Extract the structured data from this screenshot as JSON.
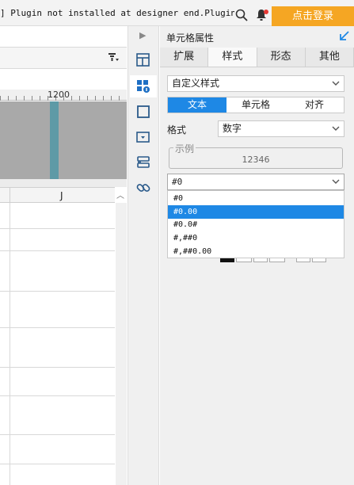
{
  "topbar": {
    "notice": "] Plugin not installed at designer end.Plugin ...",
    "search_icon": "search-icon",
    "bell_icon": "bell-icon",
    "login_label": "点击登录",
    "login_color": "#f5a623",
    "badge_color": "#e53935"
  },
  "sheet": {
    "ruler_label": "1200",
    "column_header": "J",
    "highlight_color": "#5e9aa6"
  },
  "rail": {
    "items": [
      {
        "name": "cell-expand-icon"
      },
      {
        "name": "cell-style-icon",
        "active": true
      },
      {
        "name": "cell-border-icon"
      },
      {
        "name": "widget-icon"
      },
      {
        "name": "condition-icon"
      },
      {
        "name": "hyperlink-icon"
      }
    ]
  },
  "panel": {
    "title": "单元格属性",
    "tabs": [
      {
        "label": "扩展"
      },
      {
        "label": "样式",
        "active": true
      },
      {
        "label": "形态"
      },
      {
        "label": "其他"
      }
    ],
    "style_select": "自定义样式",
    "segments": [
      {
        "label": "文本",
        "active": true
      },
      {
        "label": "单元格"
      },
      {
        "label": "对齐"
      }
    ],
    "format_label": "格式",
    "format_value": "数字",
    "example_legend": "示例",
    "example_value": "12346",
    "pattern_value": "#0",
    "pattern_options": [
      "#0",
      "#0.00",
      "#0.0#",
      "#,##0",
      "#,##0.00"
    ],
    "pattern_selected": "#0.00",
    "accent_color": "#1e88e5"
  }
}
